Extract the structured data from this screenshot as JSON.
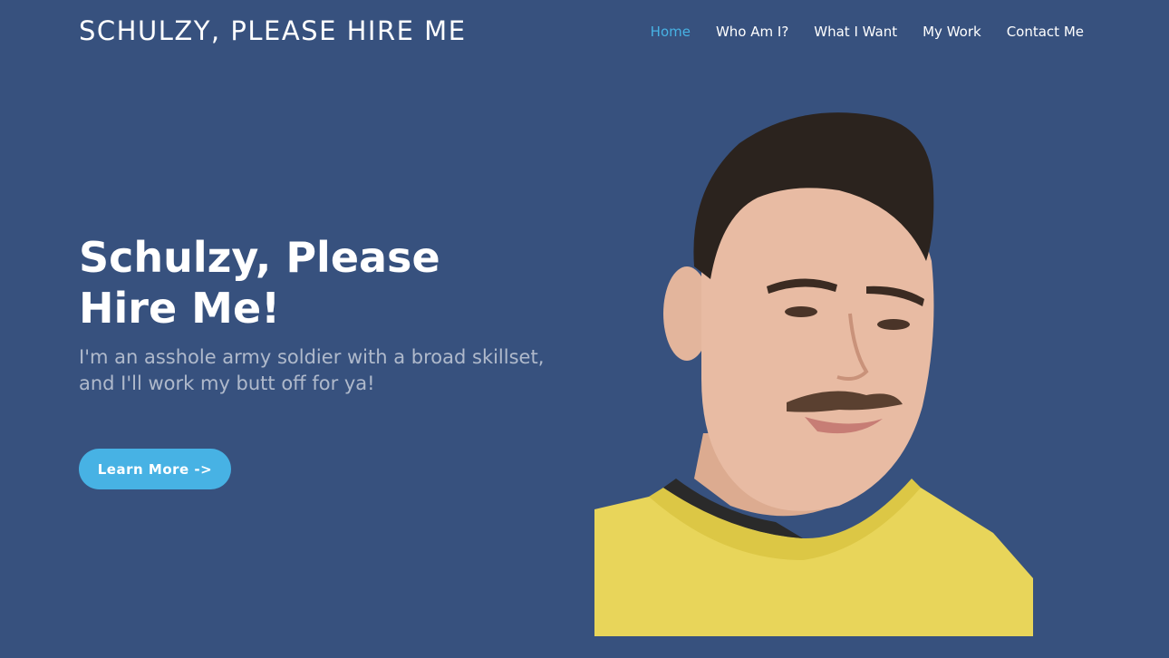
{
  "header": {
    "brand": "SCHULZY, PLEASE HIRE ME",
    "nav": [
      {
        "label": "Home",
        "active": true
      },
      {
        "label": "Who Am I?",
        "active": false
      },
      {
        "label": "What I Want",
        "active": false
      },
      {
        "label": "My Work",
        "active": false
      },
      {
        "label": "Contact Me",
        "active": false
      }
    ]
  },
  "hero": {
    "title": "Schulzy, Please Hire Me!",
    "subtitle": "I'm an asshole army soldier with a broad skillset, and I'll work my butt off for ya!",
    "cta_label": "Learn More ->"
  },
  "colors": {
    "background": "#37517e",
    "accent": "#47b2e4",
    "text": "#ffffff"
  }
}
